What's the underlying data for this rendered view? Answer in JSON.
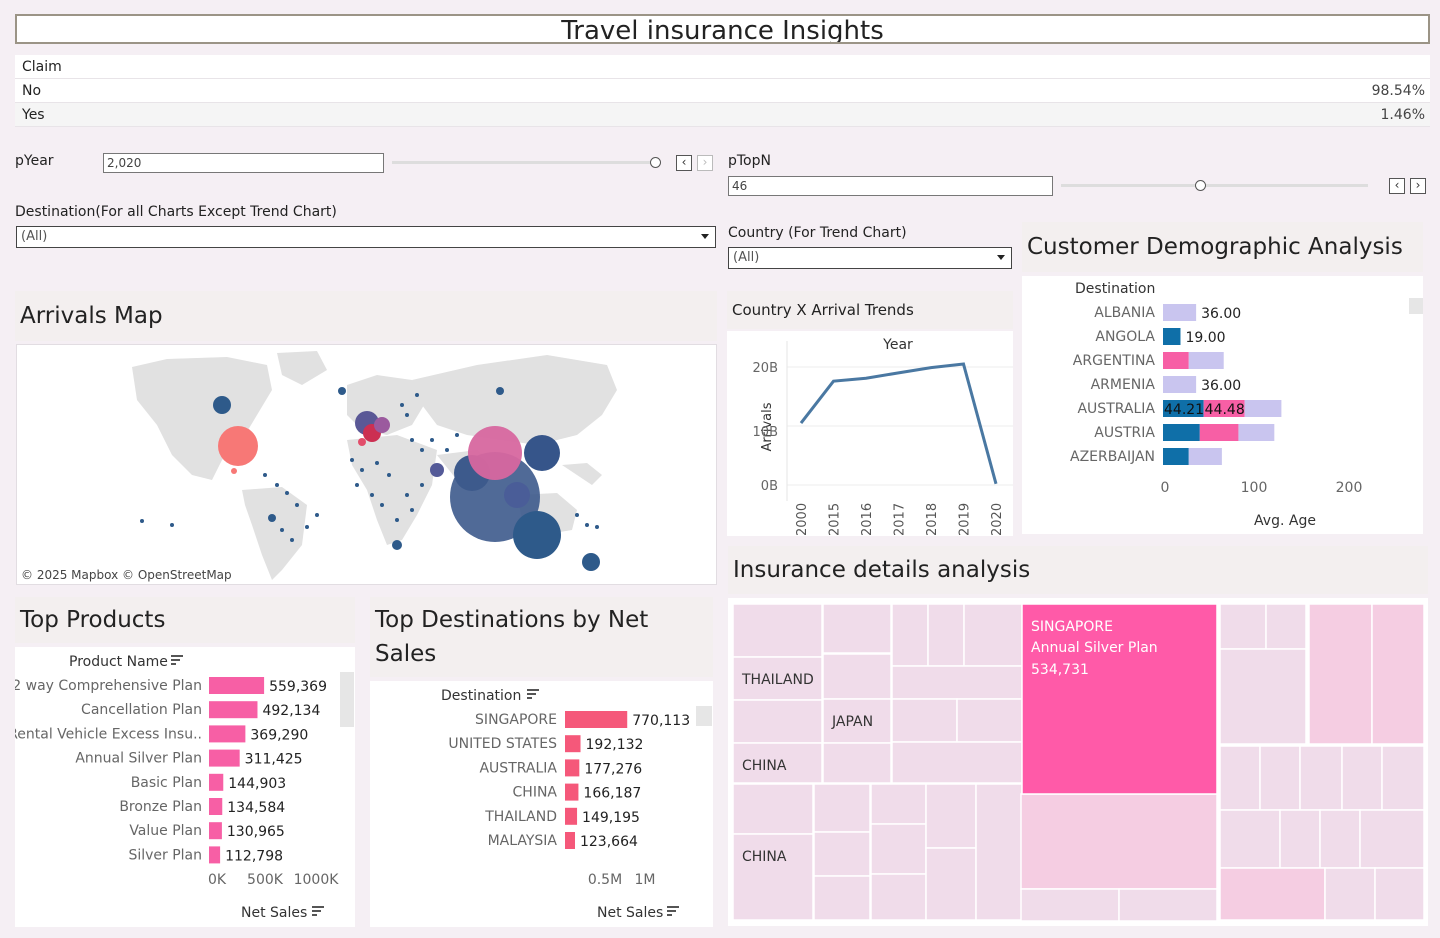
{
  "title": "Travel insurance Insights",
  "claim": {
    "header": "Claim",
    "rows": [
      {
        "label": "No",
        "pct": "98.54%"
      },
      {
        "label": "Yes",
        "pct": "1.46%"
      }
    ]
  },
  "params": {
    "pyear_label": "pYear",
    "pyear_value": "2,020",
    "ptopn_label": "pTopN",
    "ptopn_value": "46",
    "dest_label": "Destination(For all Charts Except Trend Chart)",
    "dest_value": "(All)",
    "country_label": "Country (For Trend Chart)",
    "country_value": "(All)"
  },
  "sections": {
    "map": "Arrivals Map",
    "trend": "Country X Arrival Trends",
    "demo": "Customer Demographic Analysis",
    "insurance": "Insurance details analysis",
    "products": "Top Products",
    "destinations": "Top Destinations by Net Sales"
  },
  "map": {
    "attribution": "© 2025 Mapbox  © OpenStreetMap"
  },
  "colors": {
    "pink": "#f75fa5",
    "coral": "#f5587a",
    "navy": "#2e5a8a",
    "line": "#4a78a2",
    "lavender": "#c9c5ef",
    "teal": "#0f6fa8",
    "treemap_light": "#f0dcea",
    "treemap_hot": "#ff5aa8"
  },
  "trend_chart": {
    "title": "Year",
    "ylabel": "Arrivals",
    "ytick_labels": [
      "20B",
      "10B",
      "0B"
    ]
  },
  "demo_chart": {
    "col_header": "Destination",
    "xlabel": "Avg. Age",
    "xtick_labels": [
      "0",
      "100",
      "200"
    ]
  },
  "products_chart": {
    "col_header": "Product Name",
    "xlabel": "Net Sales",
    "xtick_labels": [
      "0K",
      "500K",
      "1000K"
    ]
  },
  "dest_chart": {
    "col_header": "Destination",
    "xlabel": "Net Sales",
    "xtick_labels": [
      "0.5M",
      "1M"
    ]
  },
  "treemap": {
    "labels": {
      "singapore": "SINGAPORE",
      "singapore_plan": "Annual Silver Plan",
      "singapore_value": "534,731",
      "thailand": "THAILAND",
      "japan": "JAPAN",
      "china1": "CHINA",
      "china2": "CHINA"
    }
  },
  "chart_data": [
    {
      "type": "line",
      "title": "Year",
      "xlabel": "",
      "ylabel": "Arrivals",
      "x": [
        "2000",
        "2015",
        "2016",
        "2017",
        "2018",
        "2019",
        "2020"
      ],
      "values": [
        10.5,
        17.6,
        18.1,
        19.0,
        19.9,
        20.5,
        0.2
      ],
      "ylim": [
        0,
        22
      ],
      "yunit": "B"
    },
    {
      "type": "bar",
      "orientation": "horizontal",
      "xlabel": "Avg. Age",
      "ylabel": "Destination",
      "xlim": [
        0,
        240
      ],
      "categories": [
        "ALBANIA",
        "ANGOLA",
        "ARGENTINA",
        "ARMENIA",
        "AUSTRALIA",
        "AUSTRIA",
        "AZERBAIJAN"
      ],
      "series": [
        {
          "values": [
            null,
            19.0,
            null,
            null,
            44.21,
            40.0,
            28.0
          ]
        },
        {
          "values": [
            null,
            null,
            28.0,
            null,
            44.48,
            42.0,
            null
          ]
        },
        {
          "values": [
            36.0,
            null,
            38.0,
            36.0,
            40.0,
            39.0,
            36.0
          ]
        }
      ],
      "data_labels": [
        "36.00",
        "19.00",
        "",
        "36.00",
        "44.21|44.48",
        "",
        ""
      ]
    },
    {
      "type": "bar",
      "orientation": "horizontal",
      "xlabel": "Net Sales",
      "ylabel": "Product Name",
      "xlim": [
        0,
        1000000
      ],
      "categories": [
        "2 way Comprehensive Plan",
        "Cancellation Plan",
        "Rental Vehicle Excess Insu..",
        "Annual Silver Plan",
        "Basic Plan",
        "Bronze Plan",
        "Value Plan",
        "Silver Plan"
      ],
      "values": [
        559369,
        492134,
        369290,
        311425,
        144903,
        134584,
        130965,
        112798
      ],
      "labels": [
        "559,369",
        "492,134",
        "369,290",
        "311,425",
        "144,903",
        "134,584",
        "130,965",
        "112,798"
      ]
    },
    {
      "type": "bar",
      "orientation": "horizontal",
      "xlabel": "Net Sales",
      "ylabel": "Destination",
      "xlim": [
        0,
        1250000
      ],
      "categories": [
        "SINGAPORE",
        "UNITED STATES",
        "AUSTRALIA",
        "CHINA",
        "THAILAND",
        "MALAYSIA"
      ],
      "values": [
        770113,
        192132,
        177276,
        166187,
        149195,
        123664
      ],
      "labels": [
        "770,113",
        "192,132",
        "177,276",
        "166,187",
        "149,195",
        "123,664"
      ]
    }
  ]
}
